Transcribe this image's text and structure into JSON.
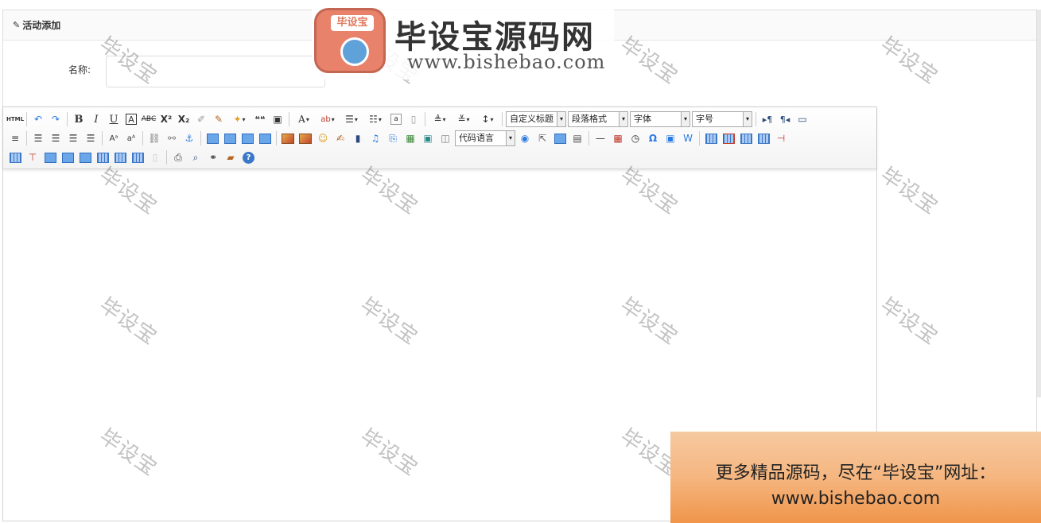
{
  "panel": {
    "title": "活动添加",
    "title_icon": "edit-icon"
  },
  "form": {
    "name_label": "名称:",
    "name_value": ""
  },
  "toolbar": {
    "source_label": "HTML",
    "bold": "B",
    "italic": "I",
    "underline": "U",
    "strike": "ABC",
    "superscript": "X²",
    "subscript": "X₂",
    "blockquote": "❝❝",
    "fontcolor": "A",
    "heading_select": "自定义标题",
    "paragraph_select": "段落格式",
    "font_select": "字体",
    "size_select": "字号",
    "code_select": "代码语言",
    "omega": "Ω",
    "help": "?"
  },
  "watermark": {
    "text": "毕设宝"
  },
  "logo": {
    "badge_text": "毕设宝",
    "title": "毕设宝源码网",
    "url": "www.bishebao.com"
  },
  "ad": {
    "line1": "更多精品源码，尽在“毕设宝”网址：",
    "line2": "www.bishebao.com"
  },
  "colors": {
    "accent_blue": "#2a7ae4",
    "ad_orange": "#f0954a",
    "logo_pink": "#e8826a"
  }
}
